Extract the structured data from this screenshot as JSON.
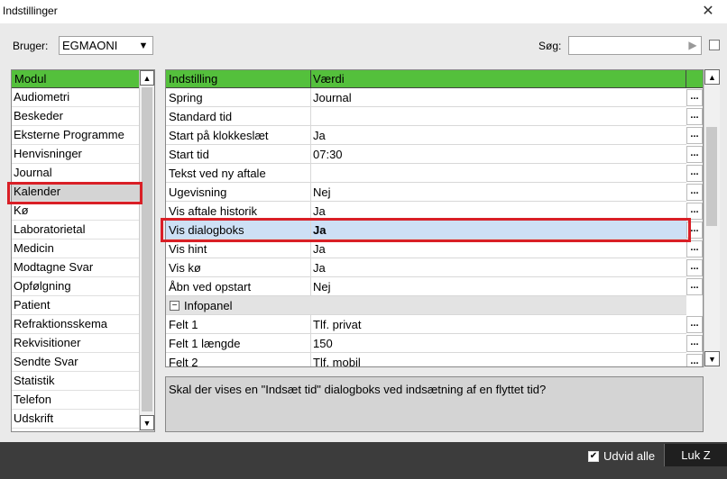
{
  "window": {
    "title": "Indstillinger",
    "close_glyph": "✕"
  },
  "user": {
    "label": "Bruger:",
    "value": "EGMAONI"
  },
  "search": {
    "label": "Søg:",
    "value": ""
  },
  "modules": {
    "header": "Modul",
    "items": [
      "Audiometri",
      "Beskeder",
      "Eksterne Programme",
      "Henvisninger",
      "Journal",
      "Kalender",
      "Kø",
      "Laboratorietal",
      "Medicin",
      "Modtagne Svar",
      "Opfølgning",
      "Patient",
      "Refraktionsskema",
      "Rekvisitioner",
      "Sendte Svar",
      "Statistik",
      "Telefon",
      "Udskrift"
    ],
    "selected": "Kalender"
  },
  "settings": {
    "header_key": "Indstilling",
    "header_value": "Værdi",
    "rows": [
      {
        "key": "Spring",
        "value": "Journal"
      },
      {
        "key": "Standard tid",
        "value": ""
      },
      {
        "key": "Start på klokkeslæt",
        "value": "Ja"
      },
      {
        "key": "Start tid",
        "value": "07:30"
      },
      {
        "key": "Tekst ved ny aftale",
        "value": ""
      },
      {
        "key": "Ugevisning",
        "value": "Nej"
      },
      {
        "key": "Vis aftale historik",
        "value": "Ja"
      },
      {
        "key": "Vis dialogboks",
        "value": "Ja"
      },
      {
        "key": "Vis hint",
        "value": "Ja"
      },
      {
        "key": "Vis kø",
        "value": "Ja"
      },
      {
        "key": "Åbn ved opstart",
        "value": "Nej"
      },
      {
        "key": "Infopanel",
        "value": ""
      },
      {
        "key": "Felt 1",
        "value": "Tlf. privat"
      },
      {
        "key": "Felt 1 længde",
        "value": "150"
      },
      {
        "key": "Felt 2",
        "value": "Tlf. mobil"
      }
    ],
    "selected": "Vis dialogboks",
    "dots_label": "..."
  },
  "description": "Skal der vises en \"Indsæt tid\" dialogboks ved indsætning af en flyttet tid?",
  "footer": {
    "expand_all_label": "Udvid alle",
    "expand_all_checked": true,
    "close_label": "Luk Z"
  },
  "colors": {
    "header_green": "#54c03c",
    "highlight_red": "#d91f26",
    "selected_blue": "#cde0f5"
  }
}
